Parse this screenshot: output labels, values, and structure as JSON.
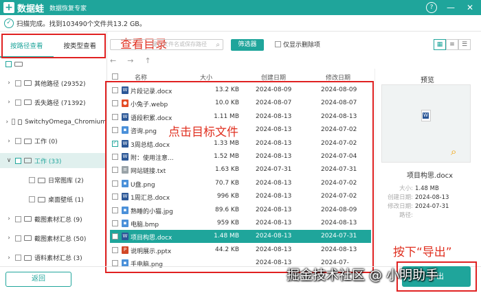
{
  "titlebar": {
    "app_name": "数据蛙",
    "subtitle": "数据恢复专家",
    "help": "?",
    "minimize": "—",
    "close": "✕"
  },
  "status": {
    "text": "扫描完成。找到103490个文件共13.2 GB。"
  },
  "tabs": [
    {
      "label": "按路径查看",
      "active": true
    },
    {
      "label": "按类型查看",
      "active": false
    }
  ],
  "annotations": {
    "view_dir": "查看目录",
    "click_file": "点击目标文件",
    "export_hint": "按下“导出”"
  },
  "toolbar": {
    "search_placeholder": "键入文件名或保存路径",
    "filter_label": "筛选器",
    "only_deleted_label": "仅显示删除项"
  },
  "tree": [
    {
      "label": "其他路径 (29352)",
      "level": 1,
      "arrow": "›",
      "selected": false
    },
    {
      "label": "丢失路径 (71392)",
      "level": 1,
      "arrow": "›",
      "selected": false
    },
    {
      "label": "SwitchyOmega_Chromium",
      "level": 1,
      "arrow": "›",
      "selected": false
    },
    {
      "label": "工作 (0)",
      "level": 1,
      "arrow": "›",
      "selected": false
    },
    {
      "label": "工作 (33)",
      "level": 1,
      "arrow": "∨",
      "selected": true
    },
    {
      "label": "日常图库 (2)",
      "level": 2,
      "arrow": "",
      "selected": false
    },
    {
      "label": "桌面壁纸 (1)",
      "level": 2,
      "arrow": "",
      "selected": false
    },
    {
      "label": "截图素材汇总 (9)",
      "level": 1,
      "arrow": "›",
      "selected": false
    },
    {
      "label": "截图素材汇总 (50)",
      "level": 1,
      "arrow": "›",
      "selected": false
    },
    {
      "label": "语料素材汇总 (3)",
      "level": 1,
      "arrow": "›",
      "selected": false
    }
  ],
  "table": {
    "headers": {
      "name": "名称",
      "size": "大小",
      "created": "创建日期",
      "modified": "修改日期"
    },
    "rows": [
      {
        "name": "片段记录.docx",
        "size": "13.2 KB",
        "created": "2024-08-09",
        "modified": "2024-08-09",
        "type": "doc",
        "checked": false,
        "selected": false
      },
      {
        "name": "小兔子.webp",
        "size": "10.0 KB",
        "created": "2024-08-07",
        "modified": "2024-08-07",
        "type": "chrome",
        "checked": false,
        "selected": false
      },
      {
        "name": "语段积累.docx",
        "size": "1.11 MB",
        "created": "2024-08-13",
        "modified": "2024-08-13",
        "type": "doc",
        "checked": false,
        "selected": false
      },
      {
        "name": "咨询.png",
        "size": "",
        "created": "2024-08-13",
        "modified": "2024-07-02",
        "type": "img",
        "checked": false,
        "selected": false
      },
      {
        "name": "3周总结.docx",
        "size": "1.33 MB",
        "created": "2024-08-13",
        "modified": "2024-07-02",
        "type": "doc",
        "checked": true,
        "selected": false
      },
      {
        "name": "附：使用注意...",
        "size": "1.52 MB",
        "created": "2024-08-13",
        "modified": "2024-07-04",
        "type": "doc",
        "checked": false,
        "selected": false
      },
      {
        "name": "网站链接.txt",
        "size": "1.63 KB",
        "created": "2024-07-31",
        "modified": "2024-07-31",
        "type": "txt",
        "checked": false,
        "selected": false
      },
      {
        "name": "U盘.png",
        "size": "70.7 KB",
        "created": "2024-08-13",
        "modified": "2024-07-02",
        "type": "img",
        "checked": false,
        "selected": false
      },
      {
        "name": "1周汇总.docx",
        "size": "996 KB",
        "created": "2024-08-13",
        "modified": "2024-07-02",
        "type": "doc",
        "checked": false,
        "selected": false
      },
      {
        "name": "熟睡的小猫.jpg",
        "size": "89.6 KB",
        "created": "2024-08-13",
        "modified": "2024-08-09",
        "type": "img",
        "checked": false,
        "selected": false
      },
      {
        "name": "电脑.bmp",
        "size": "959 KB",
        "created": "2024-08-13",
        "modified": "2024-08-13",
        "type": "img",
        "checked": false,
        "selected": false
      },
      {
        "name": "项目构思.docx",
        "size": "1.48 MB",
        "created": "2024-08-13",
        "modified": "2024-07-31",
        "type": "doc",
        "checked": false,
        "selected": true
      },
      {
        "name": "说明展示.pptx",
        "size": "44.2 KB",
        "created": "2024-08-13",
        "modified": "2024-08-13",
        "type": "ppt",
        "checked": false,
        "selected": false
      },
      {
        "name": "手电脑.png",
        "size": "",
        "created": "2024-08-13",
        "modified": "2024-07-",
        "type": "img",
        "checked": false,
        "selected": false
      }
    ]
  },
  "preview": {
    "title": "预览",
    "filename": "项目构思.docx",
    "size_label": "大小:",
    "size": "1.48 MB",
    "created_label": "创建日期:",
    "created": "2024-08-13",
    "modified_label": "修改日期:",
    "modified": "2024-07-31",
    "path_label": "路径:",
    "path": ""
  },
  "buttons": {
    "back": "返回",
    "export": "导出"
  },
  "watermark": "掘金技术社区 @ 小明助手",
  "colors": {
    "accent": "#1fa59b",
    "annotation": "#e02020"
  }
}
